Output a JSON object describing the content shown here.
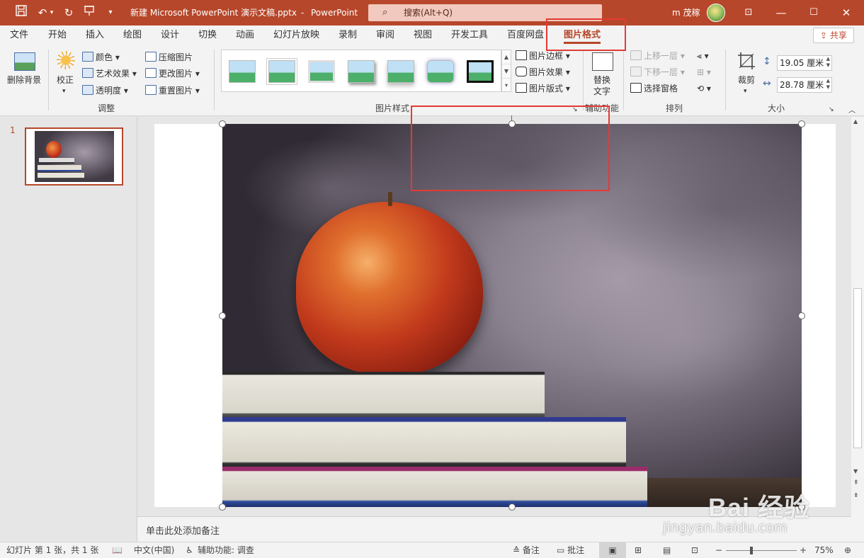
{
  "titlebar": {
    "doc_title": "新建 Microsoft PowerPoint 演示文稿.pptx",
    "sep": "-",
    "app_name": "PowerPoint",
    "search_placeholder": "搜索(Alt+Q)",
    "user_name": "m 茂稼",
    "icons": [
      "save-icon",
      "undo-icon",
      "redo-icon",
      "present-icon",
      "customize-icon",
      "search-icon",
      "ribbon-display-icon",
      "minimize-icon",
      "maximize-icon",
      "close-icon"
    ]
  },
  "tabs": [
    "文件",
    "开始",
    "插入",
    "绘图",
    "设计",
    "切换",
    "动画",
    "幻灯片放映",
    "录制",
    "审阅",
    "视图",
    "开发工具",
    "百度网盘",
    "图片格式"
  ],
  "active_tab": "图片格式",
  "share_label": "共享",
  "ribbon": {
    "remove_bg": "删除背景",
    "corrections": "校正",
    "color": "颜色",
    "artistic": "艺术效果",
    "transparency": "透明度",
    "compress": "压缩图片",
    "change": "更改图片",
    "reset": "重置图片",
    "group_adjust": "调整",
    "picture_border": "图片边框",
    "picture_effects": "图片效果",
    "picture_layout": "图片版式",
    "group_styles": "图片样式",
    "alt_text_1": "替换",
    "alt_text_2": "文字",
    "group_accessibility": "辅助功能",
    "bring_forward": "上移一层",
    "send_backward": "下移一层",
    "selection_pane": "选择窗格",
    "group_arrange": "排列",
    "crop": "裁剪",
    "height": "19.05 厘米",
    "width": "28.78 厘米",
    "group_size": "大小"
  },
  "slides": [
    {
      "number": "1"
    }
  ],
  "notes_placeholder": "单击此处添加备注",
  "status": {
    "slide_info": "幻灯片 第 1 张，共 1 张",
    "language": "中文(中国)",
    "accessibility": "辅助功能: 调查",
    "notes": "备注",
    "comments": "批注",
    "zoom": "75%"
  },
  "watermark": {
    "brand": "Bai 经验",
    "url": "jingyan.baidu.com"
  },
  "colors": {
    "accent": "#b7472a",
    "highlight_box": "#e53935"
  }
}
